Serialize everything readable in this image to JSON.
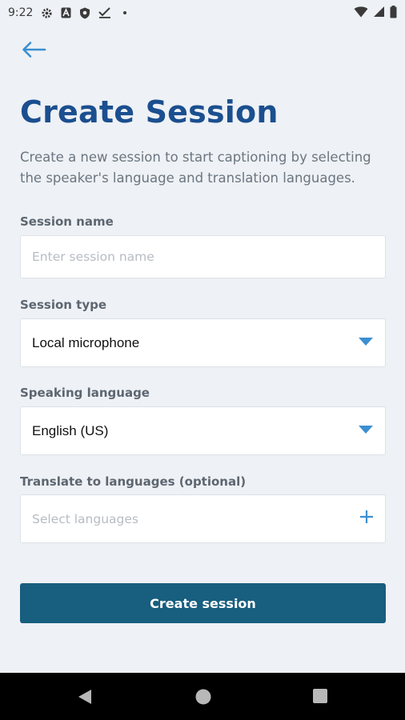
{
  "status_bar": {
    "time": "9:22",
    "left_icons": [
      "gear-icon",
      "a-box-icon",
      "shield-icon",
      "check-icon",
      "dot-icon"
    ],
    "right_icons": [
      "wifi-icon",
      "signal-icon",
      "battery-icon"
    ]
  },
  "header": {
    "back_icon": "arrow-left-icon",
    "title": "Create Session",
    "description": "Create a new session to start captioning by selecting the speaker's language and translation languages."
  },
  "form": {
    "session_name": {
      "label": "Session name",
      "value": "",
      "placeholder": "Enter session name"
    },
    "session_type": {
      "label": "Session type",
      "value": "Local microphone",
      "icon": "caret-down-icon"
    },
    "speaking_language": {
      "label": "Speaking language",
      "value": "English (US)",
      "icon": "caret-down-icon"
    },
    "translate_languages": {
      "label": "Translate to languages (optional)",
      "placeholder": "Select languages",
      "icon": "plus-icon"
    }
  },
  "actions": {
    "create_label": "Create session"
  },
  "nav": {
    "icons": [
      "back-triangle-icon",
      "home-circle-icon",
      "recents-square-icon"
    ]
  },
  "colors": {
    "title": "#1b4f8f",
    "accent": "#3b8fd0",
    "button": "#175e7f",
    "background": "#eef1f5"
  }
}
